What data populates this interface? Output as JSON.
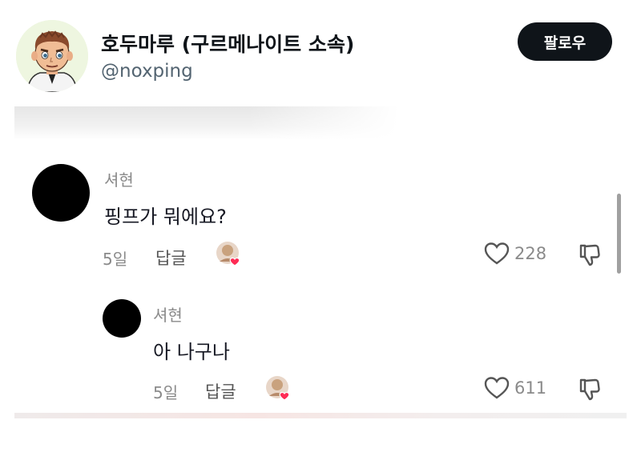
{
  "profile": {
    "display_name": "호두마루 (구르메나이트 소속)",
    "handle": "@noxping",
    "follow_label": "팔로우"
  },
  "comments": [
    {
      "author": "셔현",
      "text": "핑프가 뭐에요?",
      "age": "5일",
      "reply_label": "답글",
      "likes": "228"
    },
    {
      "author": "셔현",
      "text": "아 나구나",
      "age": "5일",
      "reply_label": "답글",
      "likes": "611"
    }
  ],
  "icons": {
    "like": "heart-outline-icon",
    "dislike": "thumbs-down-icon",
    "creator_liked": "creator-liked-heart-icon"
  },
  "colors": {
    "follow_bg": "#0f1419",
    "heart_badge": "#fe2c55",
    "secondary_text": "#8a8a8a"
  }
}
